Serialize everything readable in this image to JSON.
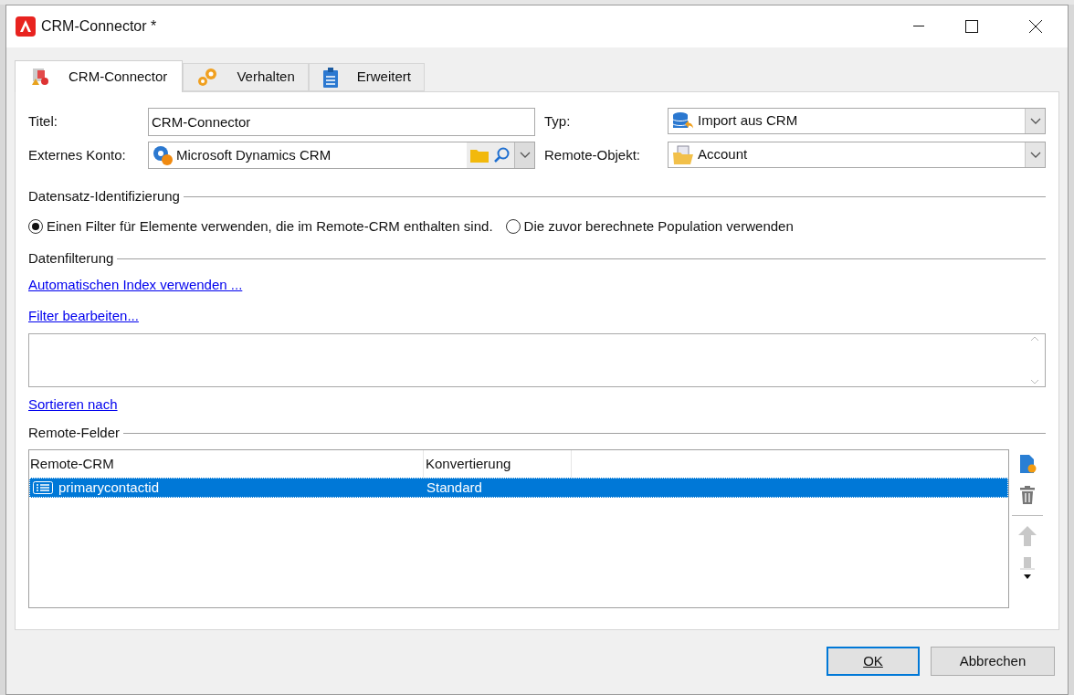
{
  "window": {
    "title": "CRM-Connector *"
  },
  "tabs": [
    {
      "label": "CRM-Connector",
      "selected": true,
      "kind": "connector"
    },
    {
      "label": "Verhalten",
      "selected": false,
      "kind": "gears"
    },
    {
      "label": "Erweitert",
      "selected": false,
      "kind": "clipboard"
    }
  ],
  "form": {
    "title_label": "Titel:",
    "title_value": "CRM-Connector",
    "account_label": "Externes Konto:",
    "account_value": "Microsoft Dynamics CRM",
    "type_label": "Typ:",
    "type_value": "Import aus CRM",
    "object_label": "Remote-Objekt:",
    "object_value": "Account"
  },
  "record_identification": {
    "heading": "Datensatz-Identifizierung",
    "options": [
      {
        "label": "Einen Filter für Elemente verwenden, die im Remote-CRM enthalten sind.",
        "selected": true
      },
      {
        "label": "Die zuvor berechnete Population verwenden",
        "selected": false
      }
    ]
  },
  "data_filtering": {
    "heading": "Datenfilterung",
    "links": [
      "Automatischen Index verwenden ...",
      "Filter bearbeiten..."
    ],
    "sort_link": "Sortieren nach"
  },
  "remote_fields": {
    "heading": "Remote-Felder",
    "columns": [
      "Remote-CRM",
      "Konvertierung"
    ],
    "rows": [
      {
        "name": "primarycontactid",
        "conversion": "Standard",
        "selected": true
      }
    ],
    "tools": [
      {
        "kind": "add",
        "disabled": false
      },
      {
        "kind": "delete",
        "disabled": false
      },
      {
        "kind": "up",
        "disabled": true
      },
      {
        "kind": "down",
        "disabled": true
      }
    ]
  },
  "buttons": [
    {
      "label": "OK",
      "kind": "default"
    },
    {
      "label": "Abbrechen",
      "kind": "normal"
    }
  ]
}
